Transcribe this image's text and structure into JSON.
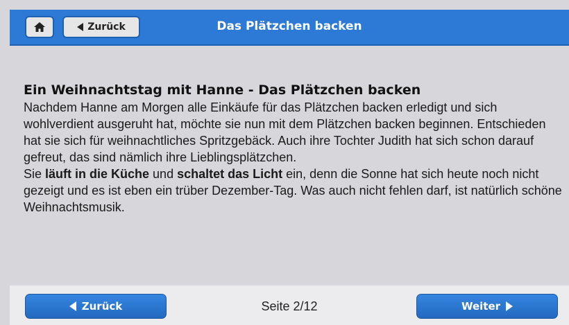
{
  "header": {
    "title": "Das Plätzchen backen",
    "back_label": "Zurück",
    "home_icon": "home-icon"
  },
  "story": {
    "heading": "Ein Weihnachtstag mit Hanne - Das Plätzchen backen",
    "para1": "Nachdem Hanne am Morgen alle Einkäufe für das Plätzchen backen erledigt und sich wohlverdient ausgeruht hat, möchte sie nun mit dem Plätzchen backen beginnen. Entschieden hat sie sich für weihnachtliches Spritzgebäck. Auch ihre Tochter Judith hat sich schon darauf gefreut, das sind nämlich ihre Lieblingsplätzchen.",
    "p2_start": "Sie ",
    "p2_action1": "läuft in die Küche",
    "p2_mid": " und ",
    "p2_action2": "schaltet das Licht",
    "p2_end": " ein, denn die Sonne hat sich heute noch nicht gezeigt und es ist eben ein trüber Dezember-Tag. Was auch nicht fehlen darf, ist natürlich schöne Weihnachtsmusik."
  },
  "footer": {
    "prev_label": "Zurück",
    "next_label": "Weiter",
    "page_indicator": "Seite 2/12"
  },
  "colors": {
    "header_bg": "#2d7ad6",
    "page_bg": "#d6d6db",
    "button_blue": "#2a74cf"
  }
}
